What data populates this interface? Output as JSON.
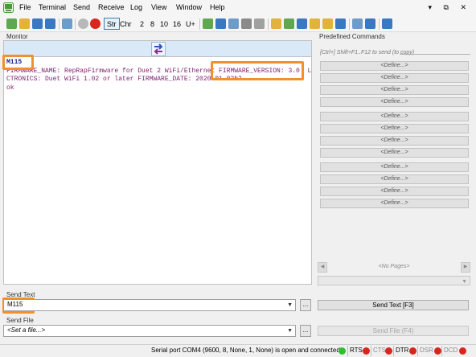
{
  "menu": [
    "File",
    "Terminal",
    "Send",
    "Receive",
    "Log",
    "View",
    "Window",
    "Help"
  ],
  "window_controls": "▾ ⧉ ✕",
  "toolbar": {
    "str_label": "Str",
    "chr_label": "Chr",
    "n2": "2",
    "n8": "8",
    "n10": "10",
    "n16": "16",
    "u_label": "U+"
  },
  "monitor": {
    "label": "Monitor",
    "lines": [
      "M115",
      "FIRMWARE_NAME: RepRapFirmware for Duet 2 WiFi/Ethernet FIRMWARE_VERSION: 3.0  L",
      "CTRONICS: Duet WiFi 1.02 or later FIRMWARE_DATE: 2020-01-03b2",
      "ok"
    ]
  },
  "predefined": {
    "label": "Predefined Commands",
    "hint": "[Ctrl+] Shift+F1..F12 to send (to copy)",
    "define_label": "<Define...>",
    "no_pages": "<No Pages>"
  },
  "send_text": {
    "label": "Send Text",
    "value": "M115",
    "browse": "...",
    "button": "Send Text [F3]"
  },
  "send_file": {
    "label": "Send File",
    "placeholder": "<Set a file...>",
    "browse": "...",
    "button": "Send File (F4)"
  },
  "status": {
    "port": "Serial port COM4 (9600, 8, None, 1, None) is open and connected",
    "signals": [
      "RTS",
      "CTS",
      "DTR",
      "DSR",
      "DCD"
    ],
    "colors": {
      "green": "#2fbf2f",
      "red": "#d8261c",
      "highlight": "#f0902e"
    }
  }
}
